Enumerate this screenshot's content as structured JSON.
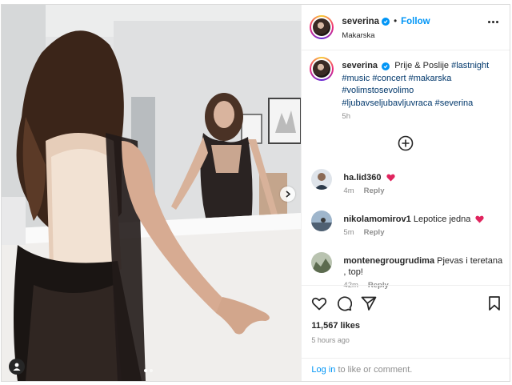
{
  "header": {
    "username": "severina",
    "separator": "•",
    "follow_label": "Follow",
    "location": "Makarska"
  },
  "caption": {
    "username": "severina",
    "text": "Prije & Poslije",
    "hashtags": [
      "#lastnight",
      "#music",
      "#concert",
      "#makarska",
      "#volimstosevolimo",
      "#ljubavseljubavljuvraca",
      "#severina"
    ],
    "time": "5h"
  },
  "comments": [
    {
      "username": "ha.lid360",
      "text": "",
      "has_heart": true,
      "time": "4m",
      "reply_label": "Reply",
      "avatar_color": "#5a6a7a"
    },
    {
      "username": "nikolamomirov1",
      "text": "Lepotice jedna",
      "has_heart": true,
      "time": "5m",
      "reply_label": "Reply",
      "avatar_color": "#7a8fa3"
    },
    {
      "username": "montenegrougrudima",
      "text": "Pjevas i teretana , top!",
      "has_heart": false,
      "time": "42m",
      "reply_label": "Reply",
      "avatar_color": "#6f7e62"
    }
  ],
  "stats": {
    "likes": "11,567 likes",
    "time_ago": "5 hours ago"
  },
  "login": {
    "link_label": "Log in",
    "rest_text": " to like or comment."
  },
  "carousel": {
    "total": 2,
    "current": 1
  },
  "colors": {
    "accent": "#0095f6",
    "heart": "#ed4956",
    "hashtag": "#00376b"
  }
}
